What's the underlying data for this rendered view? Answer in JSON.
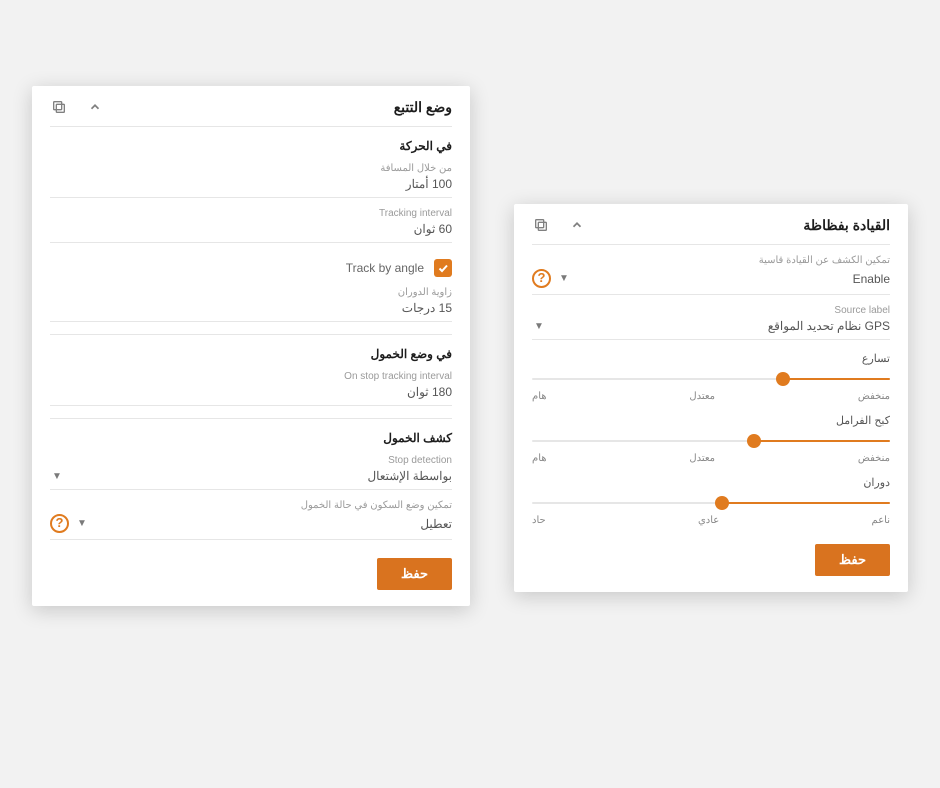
{
  "tracking": {
    "title": "وضع التتبع",
    "section_motion": "في الحركة",
    "distance_label": "من خلال المسافة",
    "distance_value": "100 أمتار",
    "interval_label": "Tracking interval",
    "interval_value": "60 ثوان",
    "track_by_angle": "Track by angle",
    "angle_label": "زاوية الدوران",
    "angle_value": "15 درجات",
    "section_idle": "في وضع الخمول",
    "on_stop_interval_label": "On stop tracking interval",
    "on_stop_interval_value": "180 ثوان",
    "section_detect": "كشف الخمول",
    "stop_detection_label": "Stop detection",
    "stop_detection_value": "بواسطة الإشتعال",
    "idle_mode_label": "تمكين وضع السكون في حالة الخمول",
    "idle_mode_value": "تعطيل",
    "save": "حفظ"
  },
  "driving": {
    "title": "القيادة بفظاظة",
    "enable_label": "تمكين الكشف عن القيادة قاسية",
    "enable_value": "Enable",
    "source_label_label": "Source label",
    "source_label_value": "GPS نظام تحديد المواقع",
    "slider_accel": {
      "label": "تسارع",
      "pct": 30,
      "legend_low": "منخفض",
      "legend_mid": "معتدل",
      "legend_high": "هام"
    },
    "slider_brake": {
      "label": "كبح الفرامل",
      "pct": 38,
      "legend_low": "منخفض",
      "legend_mid": "معتدل",
      "legend_high": "هام"
    },
    "slider_turn": {
      "label": "دوران",
      "pct": 47,
      "legend_low": "ناعم",
      "legend_mid": "عادي",
      "legend_high": "حاد"
    },
    "save": "حفظ"
  }
}
